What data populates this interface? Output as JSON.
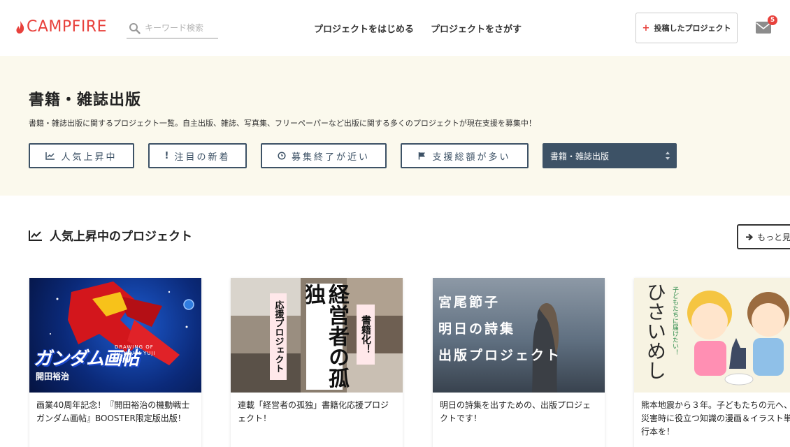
{
  "header": {
    "logo": "CAMPFIRE",
    "search_placeholder": "キーワード検索",
    "nav_start": "プロジェクトをはじめる",
    "nav_find": "プロジェクトをさがす",
    "post_button": "投稿したプロジェクト",
    "notification_count": "5"
  },
  "category": {
    "title": "書籍・雑誌出版",
    "description": "書籍・雑誌出版に関するプロジェクト一覧。自主出版、雑誌、写真集、フリーペーパーなど出版に関する多くのプロジェクトが現在支援を募集中！",
    "sort_buttons": [
      {
        "label": "人気上昇中",
        "icon": "trending-up-icon"
      },
      {
        "label": "注目の新着",
        "icon": "exclamation-icon"
      },
      {
        "label": "募集終了が近い",
        "icon": "clock-icon"
      },
      {
        "label": "支援総額が多い",
        "icon": "flag-icon"
      }
    ],
    "select_value": "書籍・雑誌出版"
  },
  "section": {
    "title": "人気上昇中のプロジェクト",
    "more_label": "もっと見"
  },
  "cards": [
    {
      "description": "画業40周年記念！『開田裕治の機動戦士ガンダム画帖』BOOSTER限定版出版！",
      "image_text": {
        "title": "ガンダム画帖",
        "author": "開田裕治",
        "sub": "DRAWING OF GUNDAM YUJI KAIDA"
      }
    },
    {
      "description": "連載「経営者の孤独」書籍化応援プロジェクト！",
      "image_text": {
        "main": "経営者の孤独",
        "left": "応援プロジェクト",
        "right": "書籍化！"
      }
    },
    {
      "description": "明日の詩集を出すための、出版プロジェクトです！",
      "image_text": {
        "line1": "宮尾節子",
        "line2": "明日の詩集",
        "line3": "出版プロジェクト"
      }
    },
    {
      "description": "熊本地震から３年。子どもたちの元へ、災害時に役立つ知識の漫画＆イラスト単行本を！",
      "image_text": {
        "title": "ひさいめし",
        "side": "子どもたちに届けたい！"
      }
    }
  ],
  "colors": {
    "brand": "#e8413c",
    "navy": "#3d5266",
    "banner_bg": "#fbf9ed"
  }
}
